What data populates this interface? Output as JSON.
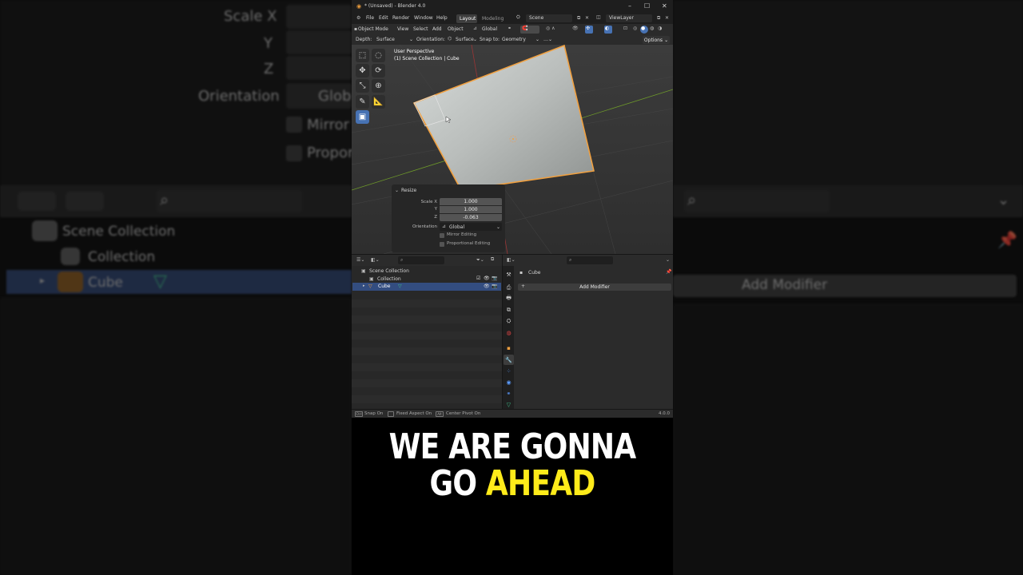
{
  "background": {
    "scale_x": "Scale X",
    "y": "Y",
    "z": "Z",
    "orientation": "Orientation",
    "orientation_value": "Glob",
    "mirror": "Mirror",
    "proportional": "Propor",
    "scene_collection": "Scene Collection",
    "collection": "Collection",
    "cube": "Cube",
    "add_modifier": "Add Modifier"
  },
  "window": {
    "title": "* (Unsaved) - Blender 4.0",
    "menus": [
      "File",
      "Edit",
      "Render",
      "Window",
      "Help"
    ],
    "workspace_tabs": [
      "Layout",
      "Modeling"
    ],
    "scene": "Scene",
    "view_layer": "ViewLayer"
  },
  "header": {
    "mode": "Object Mode",
    "menus": [
      "View",
      "Select",
      "Add",
      "Object"
    ],
    "transform_orientation": "Global"
  },
  "tool_settings": {
    "depth_label": "Depth:",
    "depth_value": "Surface",
    "orientation_label": "Orientation:",
    "orientation_value": "Surface",
    "snap_label": "Snap to:",
    "snap_value": "Geometry",
    "options": "Options"
  },
  "viewport": {
    "perspective": "User Perspective",
    "collection_info": "(1) Scene Collection | Cube"
  },
  "resize_panel": {
    "title": "Resize",
    "scale_x_label": "Scale X",
    "scale_x": "1.000",
    "y_label": "Y",
    "y": "1.000",
    "z_label": "Z",
    "z": "-0.063",
    "orientation_label": "Orientation",
    "orientation_value": "Global",
    "mirror_editing": "Mirror Editing",
    "proportional_editing": "Proportional Editing"
  },
  "outliner": {
    "scene_collection": "Scene Collection",
    "collection": "Collection",
    "cube": "Cube"
  },
  "properties": {
    "object_name": "Cube",
    "add_modifier": "Add Modifier"
  },
  "status_bar": {
    "ctrl_key": "Ctrl",
    "snap": "Snap On",
    "fixed_aspect": "Fixed Aspect On",
    "alt_key": "Alt",
    "center_pivot": "Center Pivot On",
    "version": "4.0.0"
  },
  "captions": {
    "line1": "WE ARE GONNA",
    "line2_prefix": "GO",
    "line2_highlight": "AHEAD"
  },
  "colors": {
    "accent_selection": "#4772b3",
    "object_outline": "#f0a040",
    "highlight_caption": "#ffeb1a"
  }
}
